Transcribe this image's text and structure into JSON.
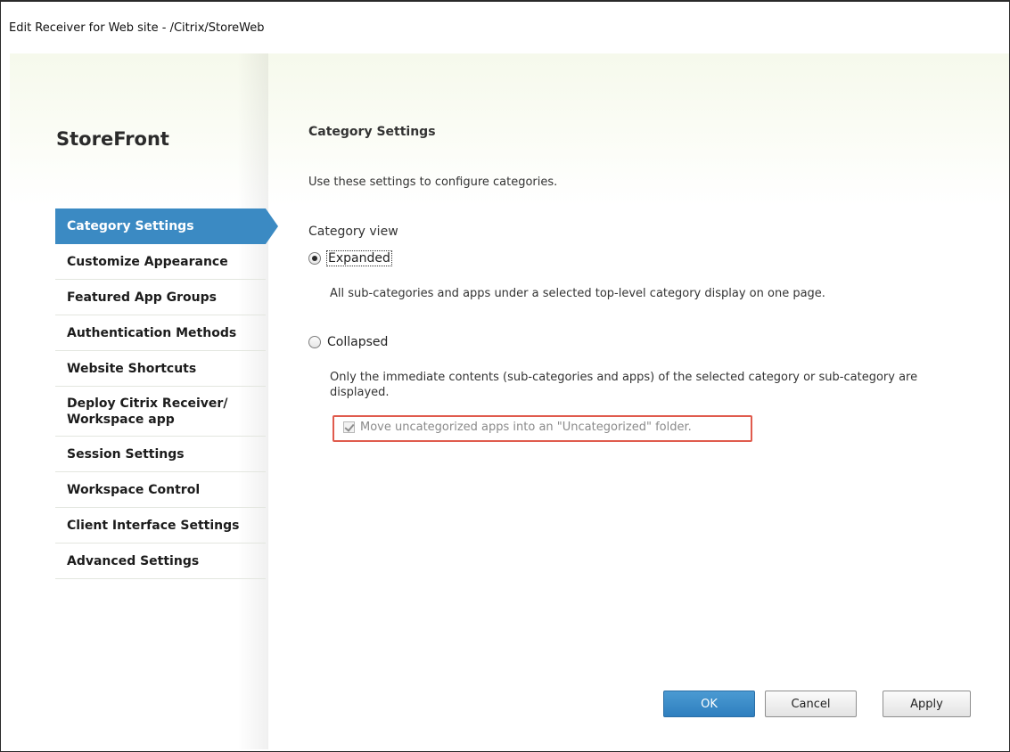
{
  "window": {
    "title": "Edit Receiver for Web site - /Citrix/StoreWeb"
  },
  "sidebar": {
    "brand": "StoreFront",
    "items": [
      {
        "label": "Category Settings",
        "active": true
      },
      {
        "label": "Customize Appearance"
      },
      {
        "label": "Featured App Groups"
      },
      {
        "label": "Authentication Methods"
      },
      {
        "label": "Website Shortcuts"
      },
      {
        "label": "Deploy Citrix Receiver/ Workspace app"
      },
      {
        "label": "Session Settings"
      },
      {
        "label": "Workspace Control"
      },
      {
        "label": "Client Interface Settings"
      },
      {
        "label": "Advanced Settings"
      }
    ]
  },
  "main": {
    "title": "Category Settings",
    "description": "Use these settings to configure categories.",
    "view_label": "Category view",
    "options": {
      "expanded": {
        "label": "Expanded",
        "checked": true,
        "description": "All sub-categories and apps under a selected top-level category display on one page."
      },
      "collapsed": {
        "label": "Collapsed",
        "checked": false,
        "description": "Only the immediate contents (sub-categories and apps) of the selected category or sub-category are displayed."
      }
    },
    "uncategorized_checkbox": {
      "label": "Move uncategorized apps into an \"Uncategorized\" folder.",
      "checked": true,
      "disabled": true
    }
  },
  "buttons": {
    "ok": "OK",
    "cancel": "Cancel",
    "apply": "Apply"
  },
  "colors": {
    "accent": "#3b8ac3",
    "highlight": "#e05b4d"
  }
}
